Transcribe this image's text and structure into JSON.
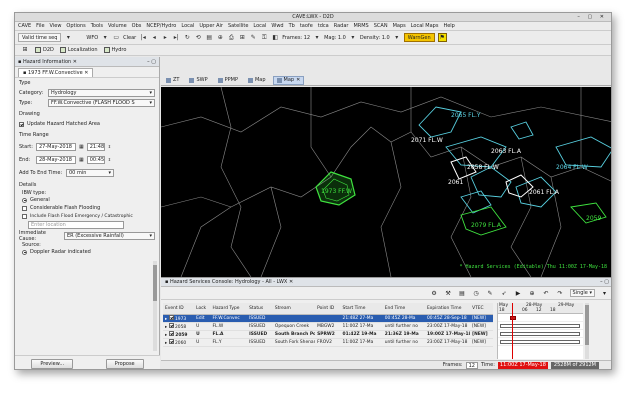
{
  "window": {
    "title": "CAVE:LWX - D2D"
  },
  "menubar": [
    "CAVE",
    "File",
    "View",
    "Options",
    "Tools",
    "Volume",
    "Obs",
    "NCEP/Hydro",
    "Local",
    "Upper Air",
    "Satellite",
    "Local",
    "Wwd",
    "Tb",
    "taofe",
    "tdca",
    "Radar",
    "MRMS",
    "SCAN",
    "Maps",
    "Local Maps",
    "Help"
  ],
  "toolbar": {
    "valid_time": "Valid time seq",
    "wfo": "WFO",
    "clear": "Clear",
    "frames": "Frames: 12",
    "mag": "Mag: 1.0",
    "density": "Density: 1.0",
    "warngen": "WarnGen"
  },
  "perspectives": [
    "D2D",
    "Localization",
    "Hydro"
  ],
  "left_panel": {
    "tab_title": "Hazard Information",
    "subtab": "1973 FF.W.Convective",
    "type_group": "Type",
    "category_label": "Category:",
    "category_value": "Hydrology",
    "type_label": "Type:",
    "type_value": "FF.W.Convective (FLASH FLOOD S",
    "drawing_group": "Drawing",
    "update_hatched": "Update Hazard Hatched Area",
    "time_group": "Time Range",
    "start_label": "Start:",
    "start_date": "27-May-2018",
    "start_time": "21:48",
    "end_label": "End:",
    "end_date": "28-May-2018",
    "end_time": "00:45",
    "add_to_end_label": "Add To End Time:",
    "add_to_end_value": "00 min",
    "details_group": "Details",
    "ibw_type_label": "IBW type:",
    "ibw_options": [
      "General",
      "Considerable Flash Flooding",
      "Include Flash Flood Emergency / Catastrophic"
    ],
    "location_placeholder": "Enter location",
    "immediate_cause_label": "Immediate Cause:",
    "immediate_cause_value": "ER (Excessive Rainfall)",
    "source_label": "Source:",
    "source_value": "Doppler Radar indicated",
    "preview_button": "Preview...",
    "propose_button": "Propose"
  },
  "editor_tabs": [
    "ZT",
    "SWP",
    "PPMP",
    "Map",
    "Map"
  ],
  "map": {
    "labels": [
      "2065 FL.Y",
      "2071 FL.W",
      "2063 FL.A",
      "2058 FL.W",
      "2064 FL.W",
      "2061",
      "2061 FL.A",
      "1973 FF.W",
      "2079 FL.A",
      "2059"
    ],
    "status": "* Hazard Services (Editable)   Thu 11:00Z 17-May-18"
  },
  "hazard_console": {
    "title": "Hazard Services Console: Hydrology - All - LWX",
    "mode": "Single",
    "columns": [
      "Event ID",
      "Lock",
      "Hazard Type",
      "Status",
      "Stream",
      "Point ID",
      "Start Time",
      "End Time",
      "Expiration Time",
      "VTEC"
    ],
    "rows": [
      [
        "1973",
        "Edit",
        "FF.W.Convec",
        "ISSUED",
        "",
        "",
        "21:48Z 27-Ma",
        "00:45Z 28-Ma",
        "00:45Z 28-Sep-18",
        "[NEW]"
      ],
      [
        "2058",
        "U",
        "FL.W",
        "ISSUED",
        "Opequon Creek",
        "MBGW2",
        "11:00Z 17-Ma",
        "until further no",
        "23:00Z 17-May-18",
        "[NEW]"
      ],
      [
        "2059",
        "U",
        "FL.A",
        "ISSUED",
        "South Branch Poto",
        "SPRW2",
        "01:42Z 19-Ma",
        "21:36Z 19-Ma",
        "19:00Z 17-May-18",
        "[NEW]"
      ],
      [
        "2060",
        "U",
        "FL.Y",
        "ISSUED",
        "South Fork Shenar",
        "FROV2",
        "11:00Z 17-Ma",
        "until further no",
        "23:00Z 17-May-18",
        "[NEW]"
      ]
    ],
    "timeline": {
      "dates": [
        "May",
        "28-May",
        "29-May"
      ],
      "hours": [
        "18",
        "06",
        "12",
        "18"
      ]
    }
  },
  "status_bar": {
    "frames_label": "Frames:",
    "frames_value": "12",
    "time_label": "Time:",
    "time_value": "11:00Z 17-May-18",
    "memory": "2528M of 2912M"
  }
}
